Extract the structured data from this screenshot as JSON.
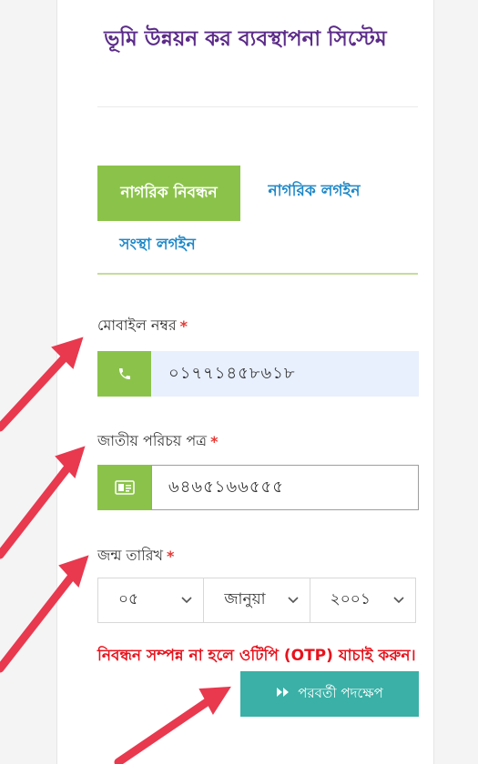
{
  "title": "ভূমি উন্নয়ন কর ব্যবস্থাপনা সিস্টেম",
  "tabs": {
    "register": "নাগরিক নিবন্ধন",
    "citizen_login": "নাগরিক লগইন",
    "org_login": "সংস্থা লগইন"
  },
  "form": {
    "mobile": {
      "label": "মোবাইল নম্বর",
      "required_mark": "*",
      "value": "০১৭৭১৪৫৮৬১৮",
      "icon": "phone-icon"
    },
    "nid": {
      "label": "জাতীয় পরিচয় পত্র",
      "required_mark": "*",
      "value": "৬৪৬৫১৬৬৫৫৫",
      "icon": "id-card-icon"
    },
    "dob": {
      "label": "জন্ম তারিখ",
      "required_mark": "*",
      "day": "০৫",
      "month": "জানুয়া",
      "year": "২০০১"
    }
  },
  "warning": "নিবন্ধন সম্পন্ন না হলে ওটিপি (OTP) যাচাই করুন।",
  "next_button": "পরবর্তী পদক্ষেপ",
  "colors": {
    "title": "#5b2b88",
    "accent_green": "#8bc34a",
    "link_blue": "#1e88c8",
    "button_teal": "#3ab0a6",
    "warning_red": "#e8121c",
    "arrow_red": "#e8394f"
  }
}
